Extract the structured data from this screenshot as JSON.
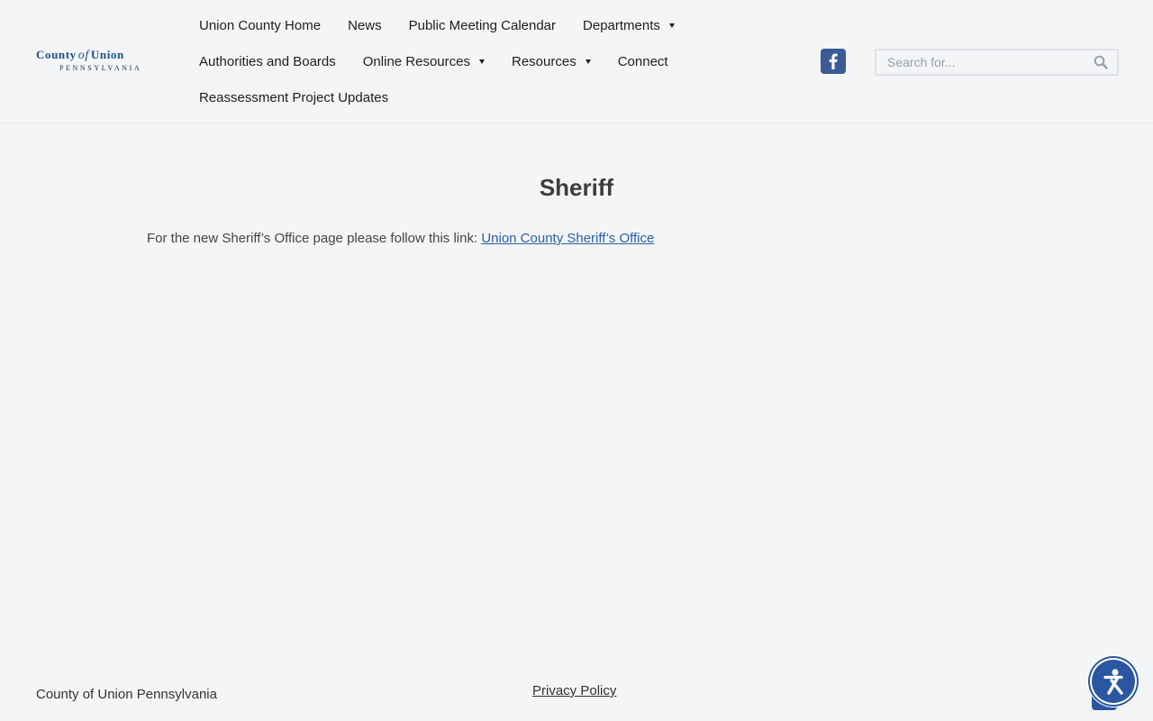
{
  "header": {
    "logo": {
      "main_left": "County",
      "main_of": "of",
      "main_right": "Union",
      "sub": "PENNSYLVANIA"
    },
    "nav": {
      "row1": [
        {
          "label": "Union County Home",
          "dropdown": false
        },
        {
          "label": "News",
          "dropdown": false
        },
        {
          "label": "Public Meeting Calendar",
          "dropdown": false
        },
        {
          "label": "Departments",
          "dropdown": true
        }
      ],
      "row2": [
        {
          "label": "Authorities and Boards",
          "dropdown": false
        },
        {
          "label": "Online Resources",
          "dropdown": true
        },
        {
          "label": "Resources",
          "dropdown": true
        },
        {
          "label": "Connect",
          "dropdown": false
        }
      ],
      "row3": [
        {
          "label": "Reassessment Project Updates",
          "dropdown": false
        }
      ]
    },
    "social": {
      "icon": "facebook-icon",
      "color": "#3b5a98"
    },
    "search": {
      "placeholder": "Search for...",
      "value": "",
      "icon": "search-icon"
    }
  },
  "main": {
    "title": "Sheriff",
    "body_text": "For the new Sheriff’s Office page please follow this link: ",
    "link_text": "Union County Sheriff’s Office"
  },
  "footer": {
    "copyright": "County of Union Pennsylvania",
    "privacy_link": "Privacy Policy"
  },
  "widgets": {
    "accessibility_icon": "accessibility-icon",
    "scroll_top_icon": "scroll-to-top-icon",
    "accent_color": "#2b57a2",
    "link_color": "#2a5ea8"
  }
}
